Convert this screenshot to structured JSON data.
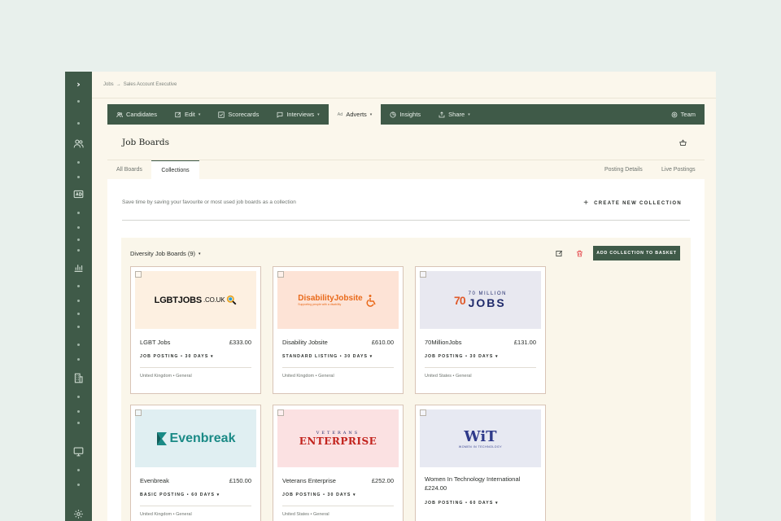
{
  "breadcrumb": {
    "root": "Jobs",
    "separator": "→",
    "current": "Sales Account Executive"
  },
  "nav": {
    "items": [
      {
        "label": "Candidates",
        "icon": "users-icon",
        "caret": false
      },
      {
        "label": "Edit",
        "icon": "edit-icon",
        "caret": true
      },
      {
        "label": "Scorecards",
        "icon": "checkbox-icon",
        "caret": false
      },
      {
        "label": "Interviews",
        "icon": "chat-icon",
        "caret": true
      },
      {
        "label": "Adverts",
        "icon": "ad-icon",
        "caret": true,
        "active": true
      },
      {
        "label": "Insights",
        "icon": "pie-chart-icon",
        "caret": false
      },
      {
        "label": "Share",
        "icon": "share-icon",
        "caret": true
      }
    ],
    "team_label": "Team",
    "caret_glyph": "▾",
    "ad_glyph": "Ad"
  },
  "page": {
    "title": "Job Boards"
  },
  "subtabs": {
    "left": [
      "All Boards",
      "Collections"
    ],
    "right": [
      "Posting Details",
      "Live Postings"
    ],
    "active": "Collections"
  },
  "content": {
    "helper_text": "Save time by saving your favourite or most used job boards as a collection",
    "create_label": "CREATE NEW COLLECTION",
    "create_glyph": "+"
  },
  "collection": {
    "title": "Diversity Job Boards (9)",
    "add_label": "ADD COLLECTION TO BASKET",
    "cards": [
      {
        "name": "LGBT Jobs",
        "price": "£333.00",
        "posting": "JOB POSTING • 30 DAYS ▾",
        "meta": "United Kingdom • General",
        "logo_bg": "#fdf0e1",
        "logo": {
          "main": "LGBTJOBS",
          "suffix": ".CO.UK"
        }
      },
      {
        "name": "Disability Jobsite",
        "price": "£610.00",
        "posting": "STANDARD LISTING • 30 DAYS ▾",
        "meta": "United Kingdom • General",
        "logo_bg": "#fde3d6",
        "logo": {
          "main": "DisabilityJobsite",
          "sub": "Supporting people with a disability"
        }
      },
      {
        "name": "70MillionJobs",
        "price": "£131.00",
        "posting": "JOB POSTING • 30 DAYS ▾",
        "meta": "United States • General",
        "logo_bg": "#e8e8f0",
        "logo": {
          "mark": "70",
          "small": "70 MILLION",
          "main": "JOBS"
        }
      },
      {
        "name": "Evenbreak",
        "price": "£150.00",
        "posting": "BASIC POSTING • 60 DAYS ▾",
        "meta": "United Kingdom • General",
        "logo_bg": "#e0eff2",
        "logo": {
          "main": "Evenbreak"
        }
      },
      {
        "name": "Veterans Enterprise",
        "price": "£252.00",
        "posting": "JOB POSTING • 30 DAYS ▾",
        "meta": "United States • General",
        "logo_bg": "#fbe1e2",
        "logo": {
          "small": "VETERANS",
          "main": "ENTERPRISE"
        }
      },
      {
        "name": "Women In Technology International",
        "price": "£224.00",
        "posting": "JOB POSTING • 60 DAYS ▾",
        "meta": "",
        "logo_bg": "#e7e9f2",
        "logo": {
          "main": "WiT",
          "sub": "WOMEN IN TECHNOLOGY"
        }
      }
    ]
  },
  "colors": {
    "brand": "#3f5a48",
    "danger": "#e5484d",
    "accent_orange": "#e96a1b",
    "accent_teal": "#1a8a86"
  }
}
